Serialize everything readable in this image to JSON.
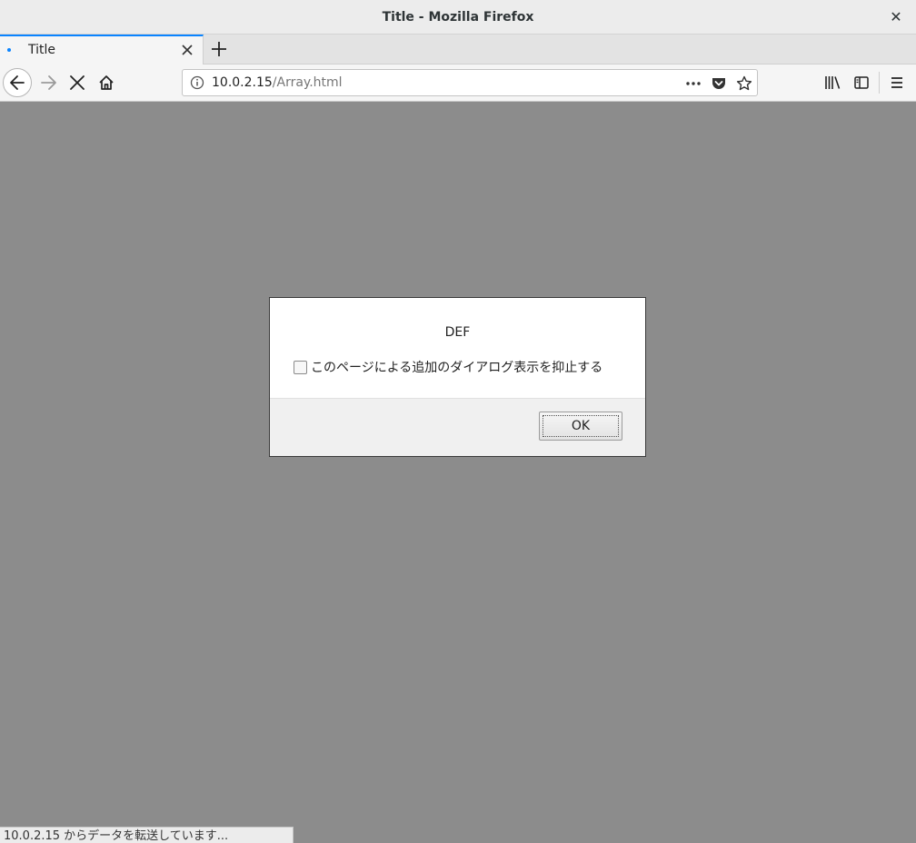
{
  "window": {
    "title": "Title - Mozilla Firefox",
    "close_glyph": "✕"
  },
  "tabs": [
    {
      "title": "Title",
      "active": true,
      "loading": true
    }
  ],
  "navbar": {
    "url_host": "10.0.2.15",
    "url_path": "/Array.html",
    "icons": [
      "back-icon",
      "forward-icon",
      "stop-icon",
      "home-icon",
      "info-icon",
      "page-actions-icon",
      "pocket-icon",
      "bookmark-star-icon",
      "library-icon",
      "sidebar-icon",
      "menu-icon"
    ]
  },
  "dialog": {
    "message": "DEF",
    "checkbox_label": "このページによる追加のダイアログ表示を抑止する",
    "checkbox_checked": false,
    "ok_label": "OK"
  },
  "status": {
    "text": "10.0.2.15 からデータを転送しています..."
  },
  "colors": {
    "accent": "#0a84ff",
    "content_overlay": "#8c8c8c"
  }
}
